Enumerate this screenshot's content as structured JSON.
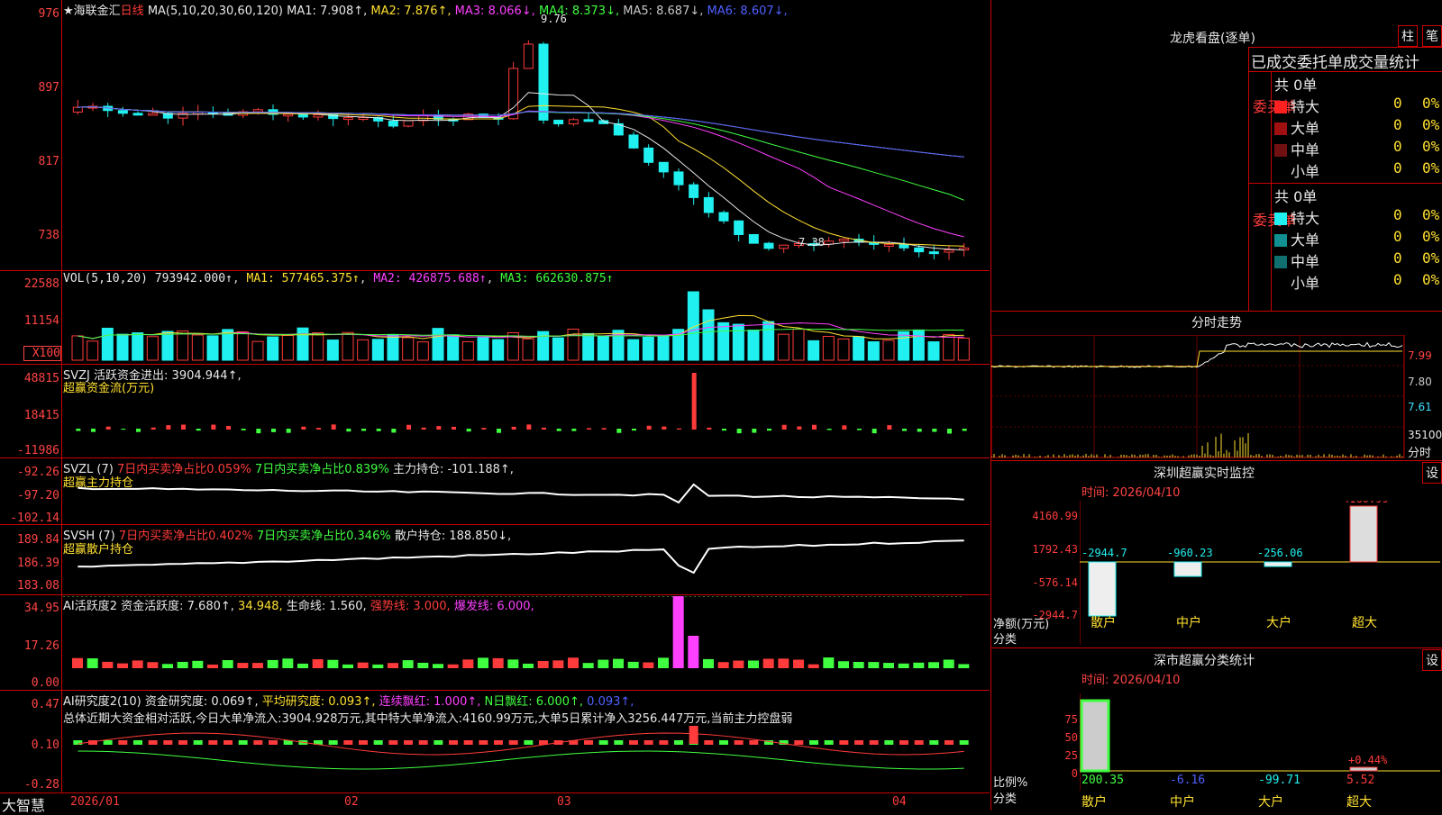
{
  "stock": {
    "title": "★海联金汇",
    "period": "日线",
    "ma_label": "MA(5,10,20,30,60,120)",
    "ma": [
      {
        "label": "MA1: 7.908↑",
        "color": "#e8e8e8"
      },
      {
        "label": "MA2: 7.876↑",
        "color": "#ffe030"
      },
      {
        "label": "MA3: 8.066↓",
        "color": "#ff40ff"
      },
      {
        "label": "MA4: 8.373↓",
        "color": "#40ff40"
      },
      {
        "label": "MA5: 8.687↓",
        "color": "#c8c8c8"
      },
      {
        "label": "MA6: 8.607↓",
        "color": "#5060ff"
      }
    ],
    "y_labels": [
      "976",
      "897",
      "817",
      "738"
    ],
    "high": "9.76",
    "low": "7.38"
  },
  "vol": {
    "label": "VOL(5,10,20)",
    "value": "793942.000↑",
    "ma1": "MA1: 577465.375↑",
    "ma2": "MA2: 426875.688↑",
    "ma3": "MA3: 662630.875↑",
    "y_labels": [
      "22588",
      "11154"
    ],
    "unit": "X100"
  },
  "svzj": {
    "label": "SVZJ",
    "text": "活跃资金进出: 3904.944↑,",
    "sub": "超赢资金流(万元)",
    "y_labels": [
      "48815",
      "18415",
      "-11986"
    ]
  },
  "svzl": {
    "label": "SVZL (7)",
    "a": "7日内买卖净占比0.059%",
    "b": "7日内买卖净占比0.839%",
    "c": "主力持仓: -101.188↑,",
    "sub": "超赢主力持仓",
    "y_labels": [
      "-92.26",
      "-97.20",
      "-102.14"
    ]
  },
  "svsh": {
    "label": "SVSH (7)",
    "a": "7日内买卖净占比0.402%",
    "b": "7日内买卖净占比0.346%",
    "c": "散户持仓: 188.850↓,",
    "sub": "超赢散户持仓",
    "y_labels": [
      "189.84",
      "186.39",
      "183.08"
    ]
  },
  "ai1": {
    "label": "AI活跃度2",
    "a": "资金活跃度: 7.680↑,",
    "b": "34.948,",
    "c": "生命线: 1.560,",
    "d": "强势线: 3.000,",
    "e": "爆发线: 6.000,",
    "y_labels": [
      "34.95",
      "17.26",
      "0.00"
    ]
  },
  "ai2": {
    "label": "AI研究度2(10)",
    "a": "资金研究度: 0.069↑,",
    "b": "平均研究度: 0.093↑,",
    "c": "连续飘红: 1.000↑,",
    "d": "N日飘红: 6.000↑,",
    "e": "0.093↑,",
    "summary": "总体近期大资金相对活跃,今日大单净流入:3904.928万元,其中特大单净流入:4160.99万元,大单5日累计净入3256.447万元,当前主力控盘弱",
    "y_labels": [
      "0.47",
      "0.10",
      "-0.28"
    ]
  },
  "xaxis": {
    "labels": [
      "2026/01",
      "02",
      "03",
      "04"
    ],
    "brand": "大智慧"
  },
  "longhu": {
    "title": "龙虎看盘(逐单)",
    "btn1": "柱",
    "btn2": "笔",
    "subtitle": "已成交委托单成交量统计",
    "buy": {
      "side": "委买单",
      "total": "共 0单",
      "rows": [
        {
          "name": "特大",
          "v": "0",
          "p": "0%",
          "c": "#ff2020"
        },
        {
          "name": "大单",
          "v": "0",
          "p": "0%",
          "c": "#a01010"
        },
        {
          "name": "中单",
          "v": "0",
          "p": "0%",
          "c": "#701010"
        },
        {
          "name": "小单",
          "v": "0",
          "p": "0%",
          "c": "#000"
        }
      ]
    },
    "sell": {
      "side": "委卖单",
      "total": "共 0单",
      "rows": [
        {
          "name": "特大",
          "v": "0",
          "p": "0%",
          "c": "#20f0f0"
        },
        {
          "name": "大单",
          "v": "0",
          "p": "0%",
          "c": "#109090"
        },
        {
          "name": "中单",
          "v": "0",
          "p": "0%",
          "c": "#107070"
        },
        {
          "name": "小单",
          "v": "0",
          "p": "0%",
          "c": "#000"
        }
      ]
    }
  },
  "fenshi": {
    "title": "分时走势",
    "y_labels": [
      "7.99",
      "7.80",
      "7.61",
      "35100",
      "分时"
    ]
  },
  "monitor": {
    "title": "深圳超赢实时监控",
    "btn": "设",
    "time": "时间: 2026/04/10",
    "y_labels": [
      "4160.99",
      "1792.43",
      "-576.14",
      "-2944.7"
    ],
    "axis_label1": "净额(万元)",
    "axis_label2": "分类",
    "values": [
      "-2944.7",
      "-960.23",
      "-256.06",
      "4160.99"
    ],
    "cats": [
      "散户",
      "中户",
      "大户",
      "超大"
    ]
  },
  "classify": {
    "title": "深市超赢分类统计",
    "btn": "设",
    "time": "时间: 2026/04/10",
    "y_labels": [
      "75",
      "50",
      "25",
      "0"
    ],
    "axis_label1": "比例%",
    "axis_label2": "分类",
    "values": [
      "200.35",
      "-6.16",
      "-99.71",
      "5.52"
    ],
    "top": "+0.44%",
    "cats": [
      "散户",
      "中户",
      "大户",
      "超大"
    ]
  }
}
